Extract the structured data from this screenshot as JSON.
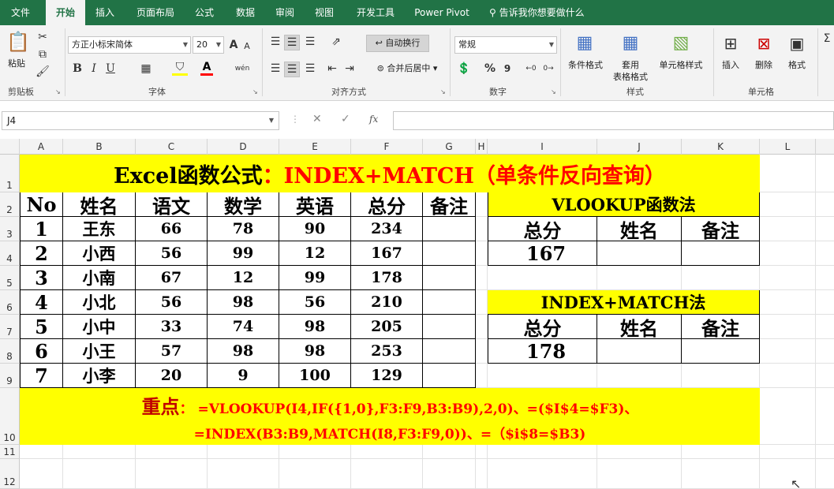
{
  "menu": {
    "items": [
      "文件",
      "开始",
      "插入",
      "页面布局",
      "公式",
      "数据",
      "审阅",
      "视图",
      "开发工具",
      "Power Pivot"
    ],
    "active": "开始",
    "tell_me": "告诉我你想要做什么"
  },
  "ribbon": {
    "clipboard": {
      "paste": "粘贴",
      "label": "剪贴板"
    },
    "font": {
      "name": "方正小标宋简体",
      "size": "20",
      "bold": "B",
      "italic": "I",
      "underline": "U",
      "label": "字体",
      "grow": "A",
      "shrink": "A",
      "font_color_letter": "A",
      "phonetic": "wén"
    },
    "alignment": {
      "wrap": "自动换行",
      "merge": "合并后居中",
      "label": "对齐方式"
    },
    "number": {
      "format": "常规",
      "percent": "%",
      "comma": "9",
      "label": "数字"
    },
    "styles": {
      "cond": "条件格式",
      "table1": "套用",
      "table2": "表格格式",
      "cell_style": "单元格样式",
      "label": "样式"
    },
    "cells": {
      "insert": "插入",
      "delete": "删除",
      "format": "格式",
      "label": "单元格"
    }
  },
  "formula_bar": {
    "name_box": "J4",
    "formula": "",
    "fx": "fx"
  },
  "sheet": {
    "columns": [
      "A",
      "B",
      "C",
      "D",
      "E",
      "F",
      "G",
      "H",
      "I",
      "J",
      "K",
      "L"
    ],
    "rows": [
      "1",
      "2",
      "3",
      "4",
      "5",
      "6",
      "7",
      "8",
      "9",
      "10",
      "11",
      "12"
    ],
    "title_black": "Excel函数公式",
    "title_red": "：INDEX+MATCH（单条件反向查询）",
    "headers": [
      "No",
      "姓名",
      "语文",
      "数学",
      "英语",
      "总分",
      "备注"
    ],
    "data": [
      [
        "1",
        "王东",
        "66",
        "78",
        "90",
        "234",
        ""
      ],
      [
        "2",
        "小西",
        "56",
        "99",
        "12",
        "167",
        ""
      ],
      [
        "3",
        "小南",
        "67",
        "12",
        "99",
        "178",
        ""
      ],
      [
        "4",
        "小北",
        "56",
        "98",
        "56",
        "210",
        ""
      ],
      [
        "5",
        "小中",
        "33",
        "74",
        "98",
        "205",
        ""
      ],
      [
        "6",
        "小王",
        "57",
        "98",
        "98",
        "253",
        ""
      ],
      [
        "7",
        "小李",
        "20",
        "9",
        "100",
        "129",
        ""
      ]
    ],
    "vlookup": {
      "title": "VLOOKUP函数法",
      "headers": [
        "总分",
        "姓名",
        "备注"
      ],
      "values": [
        "167",
        "",
        ""
      ]
    },
    "index_match": {
      "title": "INDEX+MATCH法",
      "headers": [
        "总分",
        "姓名",
        "备注"
      ],
      "values": [
        "178",
        "",
        ""
      ]
    },
    "note_label": "重点",
    "note_line1": "： =VLOOKUP(I4,IF({1,0},F3:F9,B3:B9),2,0)、=($I$4=$F3)、",
    "note_line2": "=INDEX(B3:B9,MATCH(I8,F3:F9,0))、=（$i$8=$B3)"
  },
  "colors": {
    "excel_green": "#217346",
    "highlight": "#ffff00",
    "title_red": "#ff0000",
    "note_label": "#c00000"
  }
}
